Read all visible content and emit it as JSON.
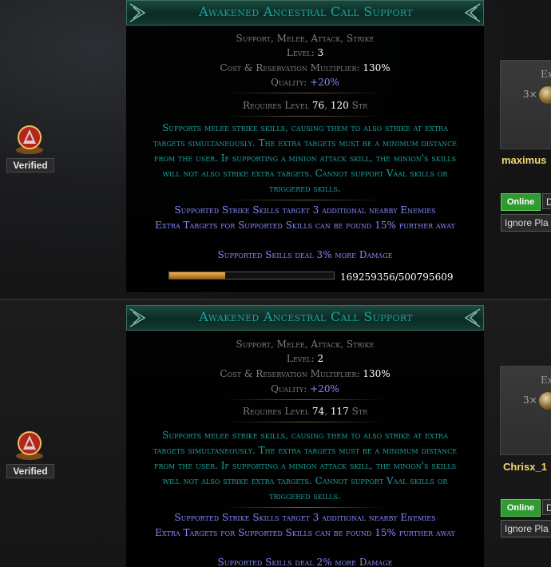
{
  "verified_label": "Verified",
  "listings": [
    {
      "name": "Awakened Ancestral Call Support",
      "tags": "Support, Melee, Attack, Strike",
      "level_label": "Level:",
      "level": "3",
      "cost_label": "Cost & Reservation Multiplier:",
      "cost": "130%",
      "quality_label": "Quality:",
      "quality": "+20%",
      "req_label": "Requires Level",
      "req_level": "76",
      "req_str": "120",
      "req_str_label": "Str",
      "description": "Supports melee strike skills, causing them to also strike at extra targets simultaneously. The extra targets must be a minimum distance from the user. If supporting a minion attack skill, the minion's skills will not also strike extra targets. Cannot support Vaal skills or triggered skills.",
      "mod1": "Supported Strike Skills target 3 additional nearby Enemies",
      "mod2": "Extra Targets for Supported Skills can be found 15% further away",
      "mod3": "Supported Skills deal 3% more Damage",
      "xp_text": "169259356/500795609",
      "xp_fraction": 0.338,
      "price_label": "Ex",
      "price_mult": "3×",
      "seller": "maximus",
      "online": "Online",
      "d_btn": "D",
      "ignore": "Ignore Pla"
    },
    {
      "name": "Awakened Ancestral Call Support",
      "tags": "Support, Melee, Attack, Strike",
      "level_label": "Level:",
      "level": "2",
      "cost_label": "Cost & Reservation Multiplier:",
      "cost": "130%",
      "quality_label": "Quality:",
      "quality": "+20%",
      "req_label": "Requires Level",
      "req_level": "74",
      "req_str": "117",
      "req_str_label": "Str",
      "description": "Supports melee strike skills, causing them to also strike at extra targets simultaneously. The extra targets must be a minimum distance from the user. If supporting a minion attack skill, the minion's skills will not also strike extra targets. Cannot support Vaal skills or triggered skills.",
      "mod1": "Supported Strike Skills target 3 additional nearby Enemies",
      "mod2": "Extra Targets for Supported Skills can be found 15% further away",
      "mod3": "Supported Skills deal 2% more Damage",
      "price_label": "Ex",
      "price_mult": "3×",
      "seller": "Chrisx_1",
      "online": "Online",
      "d_btn": "D",
      "ignore": "Ignore Pla"
    }
  ],
  "colors": {
    "gem_title": "#1ba29b",
    "augmented": "#8888ff",
    "online_green": "#2f9a2f",
    "seller_gold": "#f0d870"
  }
}
